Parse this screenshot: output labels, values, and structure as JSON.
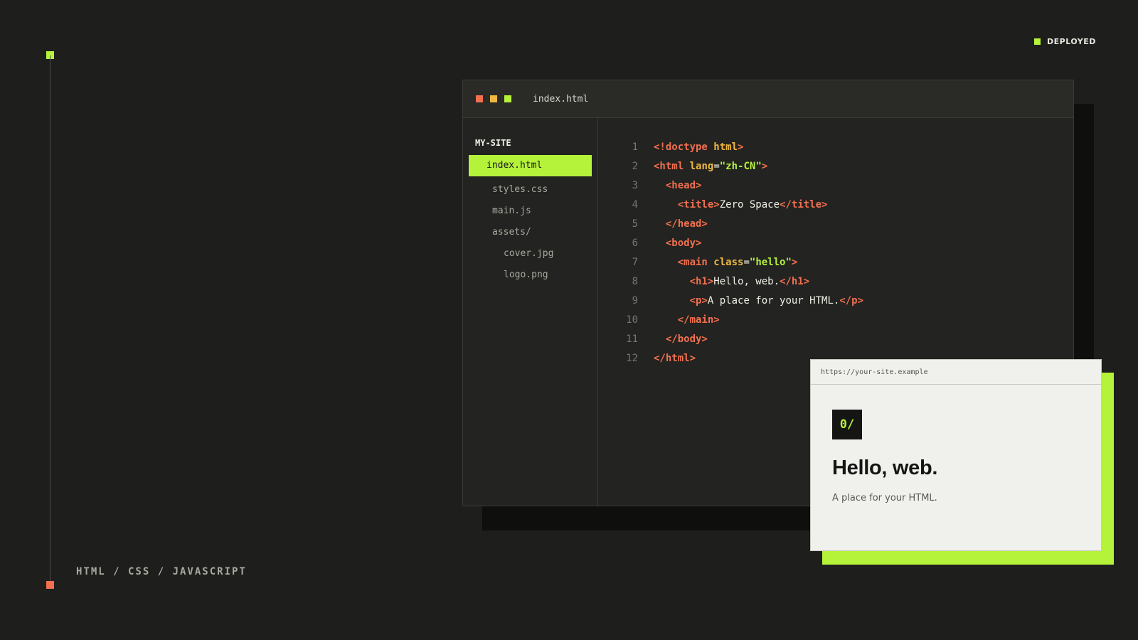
{
  "badge": {
    "label": "DEPLOYED",
    "color": "#b5f23a"
  },
  "rail": {
    "stack_label": "HTML / CSS / JAVASCRIPT"
  },
  "editor": {
    "tab_title": "index.html",
    "sidebar": {
      "root": "MY-SITE",
      "files": [
        "index.html",
        "styles.css",
        "main.js",
        "assets/",
        "cover.jpg",
        "logo.png"
      ]
    },
    "code_lines": [
      {
        "n": "1"
      },
      {
        "n": "2"
      },
      {
        "n": "3"
      },
      {
        "n": "4"
      },
      {
        "n": "5"
      },
      {
        "n": "6"
      },
      {
        "n": "7"
      },
      {
        "n": "8"
      },
      {
        "n": "9"
      },
      {
        "n": "10"
      },
      {
        "n": "11"
      },
      {
        "n": "12"
      }
    ],
    "tokens": {
      "l1": [
        "<!doctype",
        " html",
        ">"
      ],
      "l2": [
        "<html",
        " lang",
        "=",
        "\"zh-CN\"",
        ">"
      ],
      "l3": [
        "<head>"
      ],
      "l4": [
        "<title>",
        "Zero Space",
        "</title>"
      ],
      "l5": [
        "</head>"
      ],
      "l6": [
        "<body>"
      ],
      "l7": [
        "<main",
        " class",
        "=",
        "\"hello\"",
        ">"
      ],
      "l8": [
        "<h1>",
        "Hello, web.",
        "</h1>"
      ],
      "l9": [
        "<p>",
        "A place for your HTML.",
        "</p>"
      ],
      "l10": [
        "</main>"
      ],
      "l11": [
        "</body>"
      ],
      "l12": [
        "</html>"
      ]
    }
  },
  "preview": {
    "url": "https://your-site.example",
    "logo": "0/",
    "heading": "Hello, web.",
    "subtext": "A place for your HTML."
  },
  "colors": {
    "accent": "#b5f23a",
    "tag": "#f07050",
    "attribute": "#f0b840",
    "background": "#1e1e1c"
  }
}
